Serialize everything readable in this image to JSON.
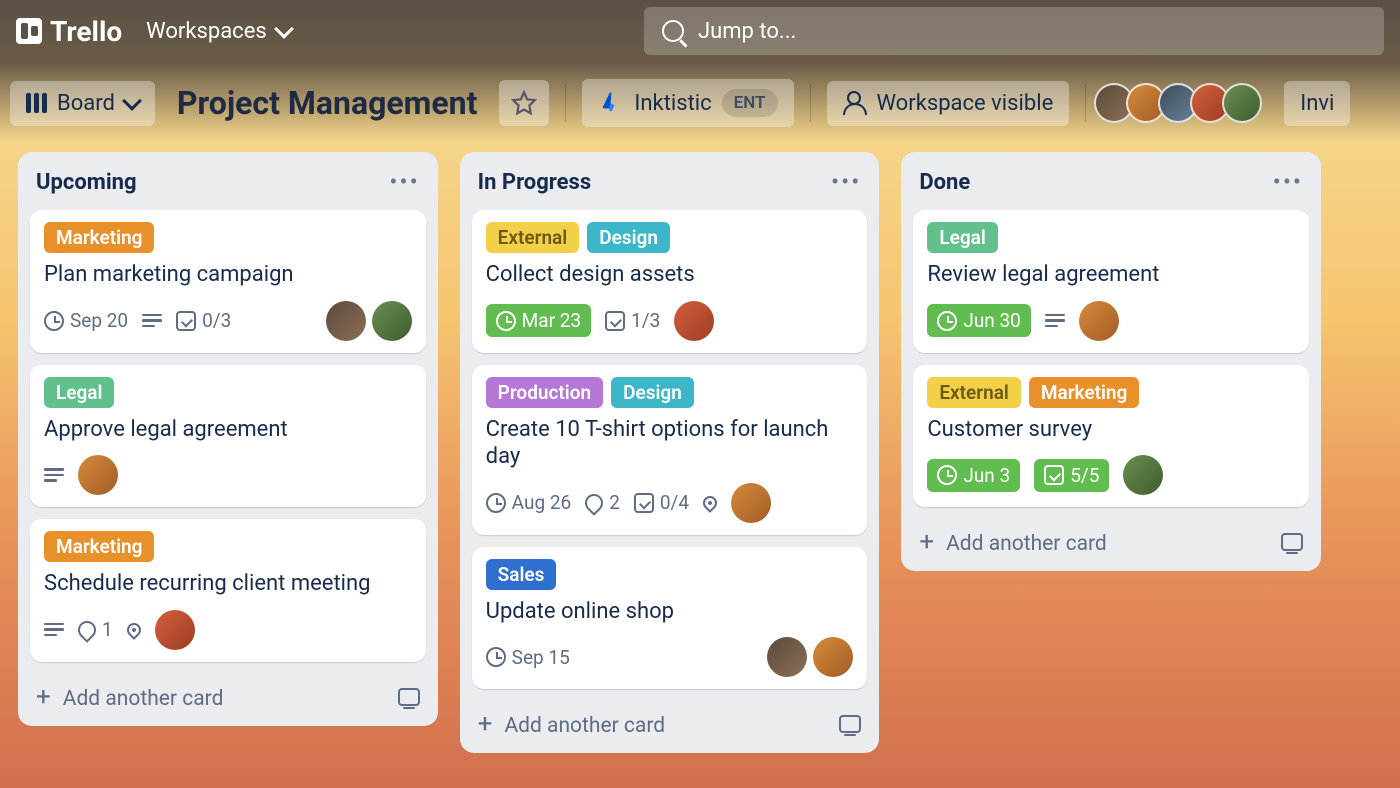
{
  "header": {
    "logo_text": "Trello",
    "workspaces_label": "Workspaces",
    "jump_placeholder": "Jump to..."
  },
  "boardbar": {
    "view_label": "Board",
    "board_name": "Project Management",
    "org_name": "Inktistic",
    "org_badge": "ENT",
    "visibility_label": "Workspace visible",
    "invite_label": "Invi"
  },
  "lists": [
    {
      "title": "Upcoming",
      "cards": [
        {
          "labels": [
            {
              "cls": "l-marketing",
              "text": "Marketing"
            }
          ],
          "title": "Plan marketing campaign",
          "date": "Sep 20",
          "date_style": "",
          "has_desc": true,
          "checklist": "0/3",
          "attachments": "",
          "has_location": false,
          "avatars": [
            "a1",
            "a5"
          ]
        },
        {
          "labels": [
            {
              "cls": "l-legal",
              "text": "Legal"
            }
          ],
          "title": "Approve legal agreement",
          "date": "",
          "date_style": "",
          "has_desc": true,
          "checklist": "",
          "attachments": "",
          "has_location": false,
          "avatars": [
            "a2"
          ]
        },
        {
          "labels": [
            {
              "cls": "l-marketing",
              "text": "Marketing"
            }
          ],
          "title": "Schedule recurring client meeting",
          "date": "",
          "date_style": "",
          "has_desc": true,
          "checklist": "",
          "attachments": "1",
          "has_location": true,
          "avatars": [
            "a4"
          ]
        }
      ],
      "add_label": "Add another card"
    },
    {
      "title": "In Progress",
      "cards": [
        {
          "labels": [
            {
              "cls": "l-external",
              "text": "External"
            },
            {
              "cls": "l-design",
              "text": "Design"
            }
          ],
          "title": "Collect design assets",
          "date": "Mar 23",
          "date_style": "due-soon",
          "has_desc": false,
          "checklist": "1/3",
          "attachments": "",
          "has_location": false,
          "avatars": [
            "a4"
          ]
        },
        {
          "labels": [
            {
              "cls": "l-production",
              "text": "Production"
            },
            {
              "cls": "l-design",
              "text": "Design"
            }
          ],
          "title": "Create 10 T-shirt options for launch day",
          "date": "Aug 26",
          "date_style": "",
          "has_desc": false,
          "checklist": "0/4",
          "attachments": "2",
          "has_location": true,
          "avatars": [
            "a2"
          ]
        },
        {
          "labels": [
            {
              "cls": "l-sales",
              "text": "Sales"
            }
          ],
          "title": "Update online shop",
          "date": "Sep 15",
          "date_style": "",
          "has_desc": false,
          "checklist": "",
          "attachments": "",
          "has_location": false,
          "avatars": [
            "a1",
            "a2"
          ]
        }
      ],
      "add_label": "Add another card"
    },
    {
      "title": "Done",
      "cards": [
        {
          "labels": [
            {
              "cls": "l-legal",
              "text": "Legal"
            }
          ],
          "title": "Review legal agreement",
          "date": "Jun 30",
          "date_style": "due-soon",
          "has_desc": true,
          "checklist": "",
          "attachments": "",
          "has_location": false,
          "avatars": [
            "a2"
          ]
        },
        {
          "labels": [
            {
              "cls": "l-external",
              "text": "External"
            },
            {
              "cls": "l-marketing",
              "text": "Marketing"
            }
          ],
          "title": "Customer survey",
          "date": "Jun 3",
          "date_style": "due-soon",
          "has_desc": false,
          "checklist": "5/5",
          "checklist_style": "due-soon",
          "attachments": "",
          "has_location": false,
          "avatars": [
            "a5"
          ]
        }
      ],
      "add_label": "Add another card"
    }
  ]
}
